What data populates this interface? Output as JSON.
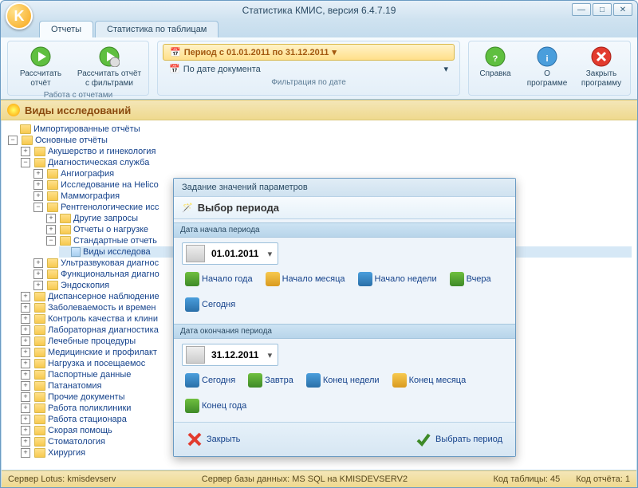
{
  "window": {
    "title": "Статистика КМИС, версия 6.4.7.19",
    "logo_letter": "K"
  },
  "tabs": {
    "reports": "Отчеты",
    "tables": "Статистика по таблицам"
  },
  "ribbon": {
    "calc": {
      "label": "Рассчитать отчёт"
    },
    "calc_filter": {
      "label": "Рассчитать отчёт с фильтрами"
    },
    "group1_caption": "Работа с отчетами",
    "period_main": "Период с 01.01.2011 по 31.12.2011",
    "period_sub": "По дате документа",
    "group2_caption": "Фильтрация по дате",
    "help": {
      "label": "Справка"
    },
    "about": {
      "label": "О программе"
    },
    "close": {
      "label": "Закрыть программу"
    }
  },
  "header": "Виды исследований",
  "tree": {
    "imported": "Импортированные отчёты",
    "main": "Основные отчёты",
    "obstetrics": "Акушерство и гинекология",
    "diag": "Диагностическая служба",
    "angio": "Ангиография",
    "helico": "Исследование на Helico",
    "mammo": "Маммография",
    "xray": "Рентгенологические исс",
    "other_q": "Другие запросы",
    "load_rep": "Отчеты о нагрузке",
    "std_rep": "Стандартные отчеть",
    "types": "Виды исследова",
    "ultra": "Ультразвуковая диагнос",
    "func": "Функциональная диагно",
    "endo": "Эндоскопия",
    "disp": "Диспансерное наблюдение",
    "morb": "Заболеваемость и времен",
    "qc": "Контроль качества и клини",
    "lab": "Лабораторная диагностика",
    "proc": "Лечебные процедуры",
    "med": "Медицинские и профилакт",
    "visits": "Нагрузка и посещаемос",
    "passport": "Паспортные данные",
    "path": "Патанатомия",
    "other_docs": "Прочие документы",
    "poly": "Работа поликлиники",
    "hosp": "Работа стационара",
    "emerg": "Скорая помощь",
    "dental": "Стоматология",
    "surg": "Хирургия"
  },
  "dialog": {
    "title": "Задание значений параметров",
    "header": "Выбор периода",
    "start_label": "Дата начала периода",
    "start_date": "01.01.2011",
    "end_label": "Дата окончания периода",
    "end_date": "31.12.2011",
    "quick_start": {
      "year": "Начало года",
      "month": "Начало месяца",
      "week": "Начало недели",
      "yesterday": "Вчера",
      "today": "Сегодня"
    },
    "quick_end": {
      "today": "Сегодня",
      "tomorrow": "Завтра",
      "week": "Конец недели",
      "month": "Конец месяца",
      "year": "Конец года"
    },
    "close": "Закрыть",
    "select": "Выбрать период"
  },
  "status": {
    "lotus": "Сервер Lotus: kmisdevserv",
    "db": "Сервер базы данных: MS SQL на KMISDEVSERV2",
    "tbl": "Код таблицы: 45",
    "rep": "Код отчёта: 1"
  }
}
